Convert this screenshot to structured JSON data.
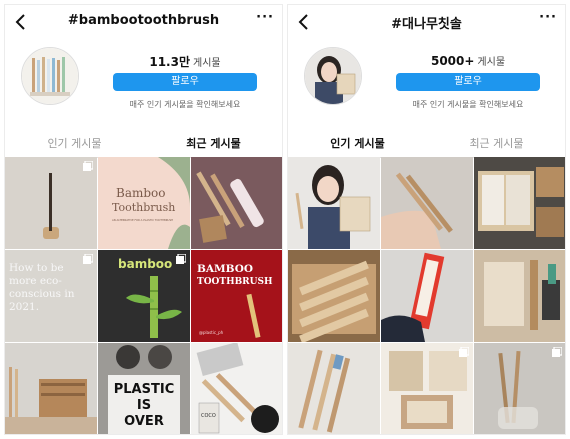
{
  "panels": [
    {
      "title": "#bambootoothbrush",
      "post_count": "11.3만",
      "post_label": "게시물",
      "follow_label": "팔로우",
      "note": "매주 인기 게시물을 확인해보세요",
      "tab_left": "인기 게시물",
      "tab_right": "최근 게시물",
      "tiles": {
        "t2_line1": "Bamboo",
        "t2_line2": "Toothbrush",
        "t2_small": "AN ALTERNATIVE FOR A PLASTIC TOOTHBRUSH",
        "t4_text": "How to be more eco-conscious in 2021.",
        "t5_text": "bamboo",
        "t6_line1": "BAMBOO",
        "t6_line2": "TOOTHBRUSH",
        "t6_small": "@plastic_ph",
        "t8_line1": "PLASTIC",
        "t8_line2": "IS",
        "t8_line3": "OVER",
        "t9_text": "COCO"
      }
    },
    {
      "title": "#대나무칫솔",
      "post_count": "5000+",
      "post_label": "게시물",
      "follow_label": "팔로우",
      "note": "매주 인기 게시물을 확인해보세요",
      "tab_left": "인기 게시물",
      "tab_right": "최근 게시물"
    }
  ],
  "colors": {
    "accent": "#1e96ee"
  },
  "icons": {
    "back": "chevron-left-icon",
    "more": "more-options-icon",
    "multi": "multiple-posts-icon"
  }
}
